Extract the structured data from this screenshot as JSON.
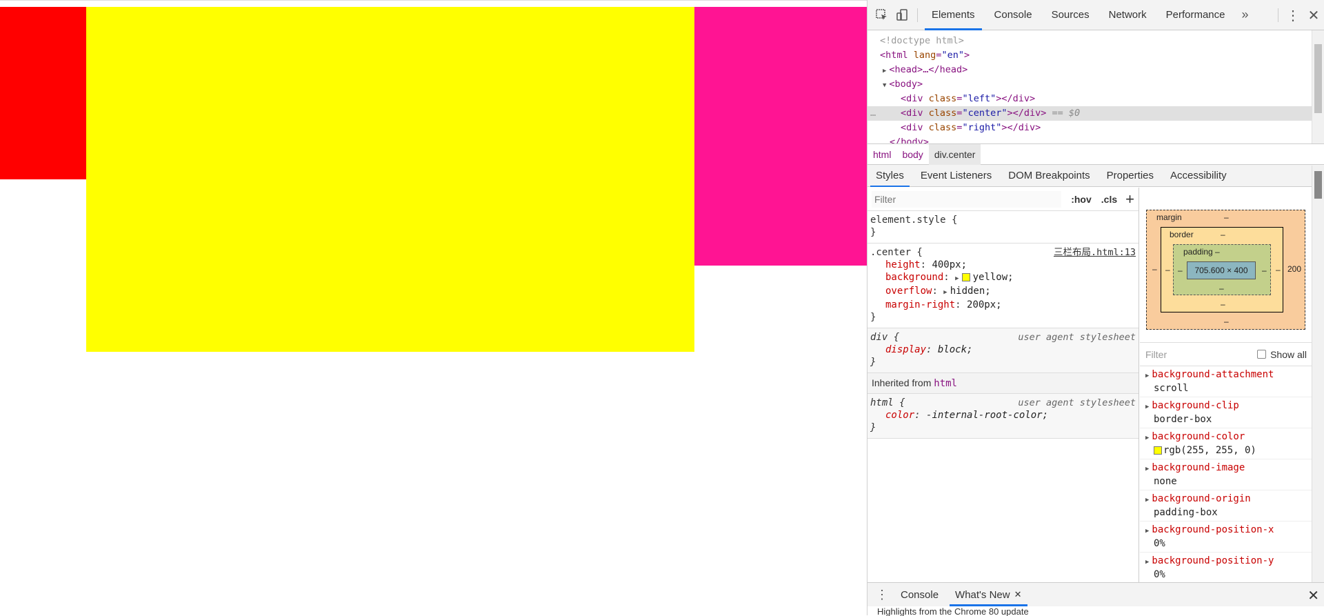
{
  "page": {
    "boxes": {
      "left_color": "#ff0000",
      "center_color": "#ffff00",
      "right_color": "#ff1493"
    }
  },
  "devtools": {
    "tabs": [
      "Elements",
      "Console",
      "Sources",
      "Network",
      "Performance"
    ],
    "more_label": "»",
    "kebab_label": "⋮",
    "close_label": "✕",
    "dom": [
      {
        "text": "<!doctype html>"
      },
      {
        "tag_open": "<html",
        "attr": "lang",
        "value": "\"en\"",
        "tag_close": ">"
      },
      {
        "arrow": "▶",
        "text": "<head>…</head>"
      },
      {
        "arrow": "▼",
        "text": "<body>"
      },
      {
        "tag_open": "<div",
        "attr": "class",
        "value": "\"left\"",
        "tag_close": "></div>"
      },
      {
        "tag_open": "<div",
        "attr": "class",
        "value": "\"center\"",
        "tag_close": "></div>",
        "suffix": " == $0",
        "prefix": "…"
      },
      {
        "tag_open": "<div",
        "attr": "class",
        "value": "\"right\"",
        "tag_close": "></div>"
      },
      {
        "text": "</body>"
      }
    ],
    "breadcrumbs": [
      "html",
      "body",
      "div.center"
    ],
    "sub_tabs": [
      "Styles",
      "Event Listeners",
      "DOM Breakpoints",
      "Properties",
      "Accessibility"
    ],
    "styles": {
      "filter_placeholder": "Filter",
      "hov": ":hov",
      "cls": ".cls",
      "plus": "+",
      "element_style": "element.style {",
      "close_brace": "}",
      "center_rule": {
        "selector": ".center {",
        "source": "三栏布局.html:13",
        "props": [
          {
            "name": "height",
            "value": "400px;"
          },
          {
            "name": "background",
            "value": "yellow;"
          },
          {
            "name": "overflow",
            "value": "hidden;"
          },
          {
            "name": "margin-right",
            "value": "200px;"
          }
        ]
      },
      "div_rule": {
        "selector": "div {",
        "source": "user agent stylesheet",
        "props": [
          {
            "name": "display",
            "value": "block;"
          }
        ]
      },
      "inherited_label": "Inherited from",
      "inherited_from": "html",
      "html_rule": {
        "selector": "html {",
        "source": "user agent stylesheet",
        "props": [
          {
            "name": "color",
            "value": "-internal-root-color;"
          }
        ]
      }
    },
    "box_model": {
      "margin_label": "margin",
      "border_label": "border",
      "padding_label": "padding –",
      "content_size": "705.600 × 400",
      "dash": "–",
      "margin_right": "200"
    },
    "computed": {
      "filter_placeholder": "Filter",
      "show_all": "Show all",
      "props": [
        {
          "name": "background-attachment",
          "value": "scroll"
        },
        {
          "name": "background-clip",
          "value": "border-box"
        },
        {
          "name": "background-color",
          "value": "rgb(255, 255, 0)",
          "swatch": true
        },
        {
          "name": "background-image",
          "value": "none"
        },
        {
          "name": "background-origin",
          "value": "padding-box"
        },
        {
          "name": "background-position-x",
          "value": "0%"
        },
        {
          "name": "background-position-y",
          "value": "0%"
        }
      ]
    },
    "drawer": {
      "tabs": [
        "Console",
        "What's New"
      ],
      "close_label": "✕",
      "subtext": "Highlights from the Chrome 80 update"
    }
  }
}
